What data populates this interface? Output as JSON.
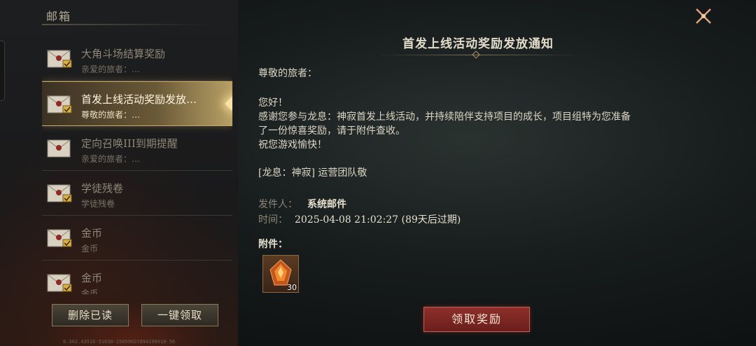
{
  "panel": {
    "title": "邮箱"
  },
  "mail_list": [
    {
      "title": "大角斗场结算奖励",
      "preview": "亲爱的旅者：…",
      "selected": false,
      "has_attachment": true
    },
    {
      "title": "首发上线活动奖励发放…",
      "preview": "尊敬的旅者：…",
      "selected": true,
      "has_attachment": true
    },
    {
      "title": "定向召唤III到期提醒",
      "preview": "亲爱的旅者：…",
      "selected": false,
      "has_attachment": false
    },
    {
      "title": "学徒残卷",
      "preview": "学徒残卷",
      "selected": false,
      "has_attachment": true
    },
    {
      "title": "金币",
      "preview": "金币",
      "selected": false,
      "has_attachment": true
    },
    {
      "title": "金币",
      "preview": "金币",
      "selected": false,
      "has_attachment": true
    }
  ],
  "buttons": {
    "delete_read": "删除已读",
    "claim_all": "一键领取",
    "claim_reward": "领取奖励"
  },
  "version_text": "0.302.43516-51030-15059027894190018-56",
  "detail": {
    "title": "首发上线活动奖励发放通知",
    "greeting": "尊敬的旅者：",
    "hello": "您好！",
    "line1": "感谢您参与龙息：神寂首发上线活动，并持续陪伴支持项目的成长，项目组特为您准备",
    "line2": "了一份惊喜奖励，请于附件查收。",
    "line3": "祝您游戏愉快！",
    "signature": "[龙息：神寂] 运营团队敬",
    "sender_label": "发件人：",
    "sender_value": "系统邮件",
    "time_label": "时间：",
    "time_value": "2025-04-08 21:02:27 (89天后过期)",
    "attachment_label": "附件：",
    "attachment_count": "30"
  },
  "colors": {
    "accent_gold": "#c9a868",
    "claim_button": "#8e2f2a",
    "close_icon": "#e0a57a"
  },
  "icons": [
    "envelope-icon",
    "attachment-check-icon",
    "close-icon",
    "crystal-item-icon",
    "selection-diamond-icon"
  ]
}
